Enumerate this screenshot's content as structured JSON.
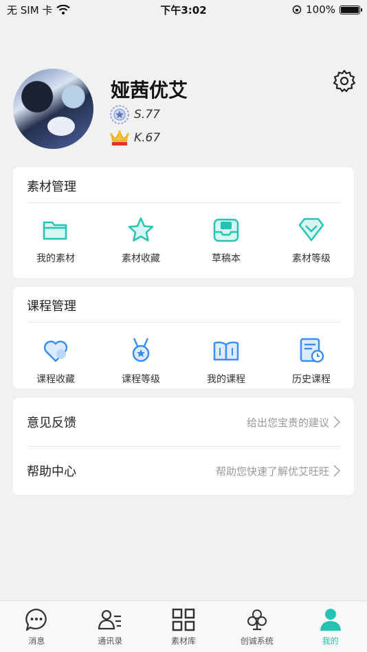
{
  "status_bar": {
    "carrier": "无 SIM 卡",
    "time": "下午3:02",
    "battery": "100%"
  },
  "profile": {
    "name": "娅茜优艾",
    "rank_s": "S.77",
    "rank_k": "K.67"
  },
  "material": {
    "title": "素材管理",
    "items": [
      {
        "label": "我的素材",
        "icon": "folder-icon"
      },
      {
        "label": "素材收藏",
        "icon": "star-icon"
      },
      {
        "label": "草稿本",
        "icon": "draft-box-icon"
      },
      {
        "label": "素材等级",
        "icon": "diamond-icon"
      }
    ]
  },
  "course": {
    "title": "课程管理",
    "items": [
      {
        "label": "课程收藏",
        "icon": "heart-icon"
      },
      {
        "label": "课程等级",
        "icon": "medal-icon"
      },
      {
        "label": "我的课程",
        "icon": "book-icon"
      },
      {
        "label": "历史课程",
        "icon": "history-icon"
      }
    ]
  },
  "links": [
    {
      "title": "意见反馈",
      "hint": "给出您宝贵的建议"
    },
    {
      "title": "帮助中心",
      "hint": "帮助您快速了解优艾旺旺"
    }
  ],
  "tabbar": [
    {
      "label": "消息",
      "icon": "chat-bubble-icon"
    },
    {
      "label": "通讯录",
      "icon": "contacts-icon"
    },
    {
      "label": "素材库",
      "icon": "grid-icon"
    },
    {
      "label": "创诚系统",
      "icon": "clover-icon"
    },
    {
      "label": "我的",
      "icon": "user-icon",
      "active": true
    }
  ],
  "colors": {
    "accent": "#24c4b4",
    "icon_blue": "#3c8df0",
    "background": "#f1f1f1"
  }
}
